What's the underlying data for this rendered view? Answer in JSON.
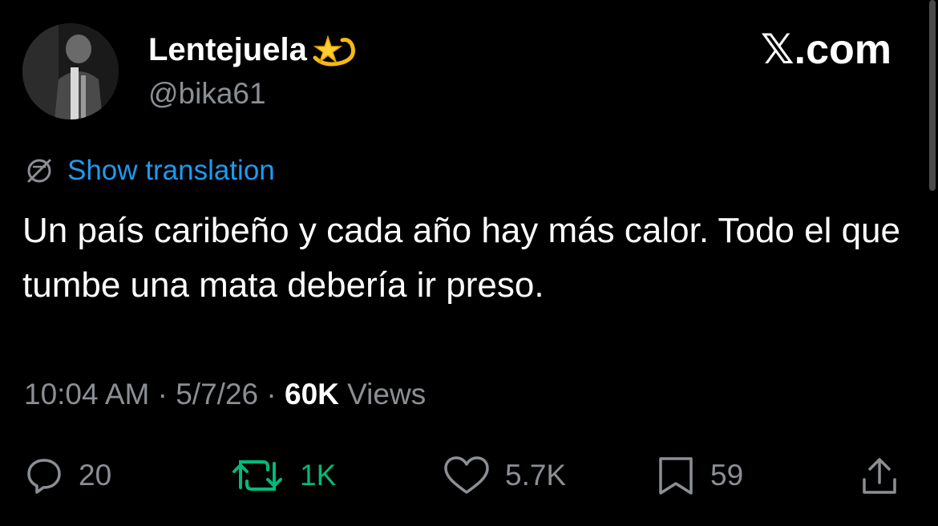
{
  "author": {
    "display_name": "Lentejuela",
    "emoji_icon": "dizzy-star-icon",
    "handle": "@bika61"
  },
  "brand": "𝕏.com",
  "translation": {
    "icon": "globe-icon",
    "label": "Show translation"
  },
  "tweet": {
    "text": "Un país caribeño y cada año hay más calor. Todo el que tumbe una mata debería ir preso."
  },
  "meta": {
    "time": "10:04 AM",
    "sep1": " · ",
    "date": "5/7/26",
    "sep2": " · ",
    "views_count": "60K",
    "views_label": " Views"
  },
  "actions": {
    "reply": {
      "icon": "reply-icon",
      "count": "20"
    },
    "retweet": {
      "icon": "retweet-icon",
      "count": "1K"
    },
    "like": {
      "icon": "heart-icon",
      "count": "5.7K"
    },
    "bookmark": {
      "icon": "bookmark-icon",
      "count": "59"
    },
    "share": {
      "icon": "share-icon"
    }
  },
  "colors": {
    "background": "#000000",
    "link_blue": "#1d9bf0",
    "retweet_green": "#00ba7c",
    "muted_gray": "#8b8f94"
  }
}
